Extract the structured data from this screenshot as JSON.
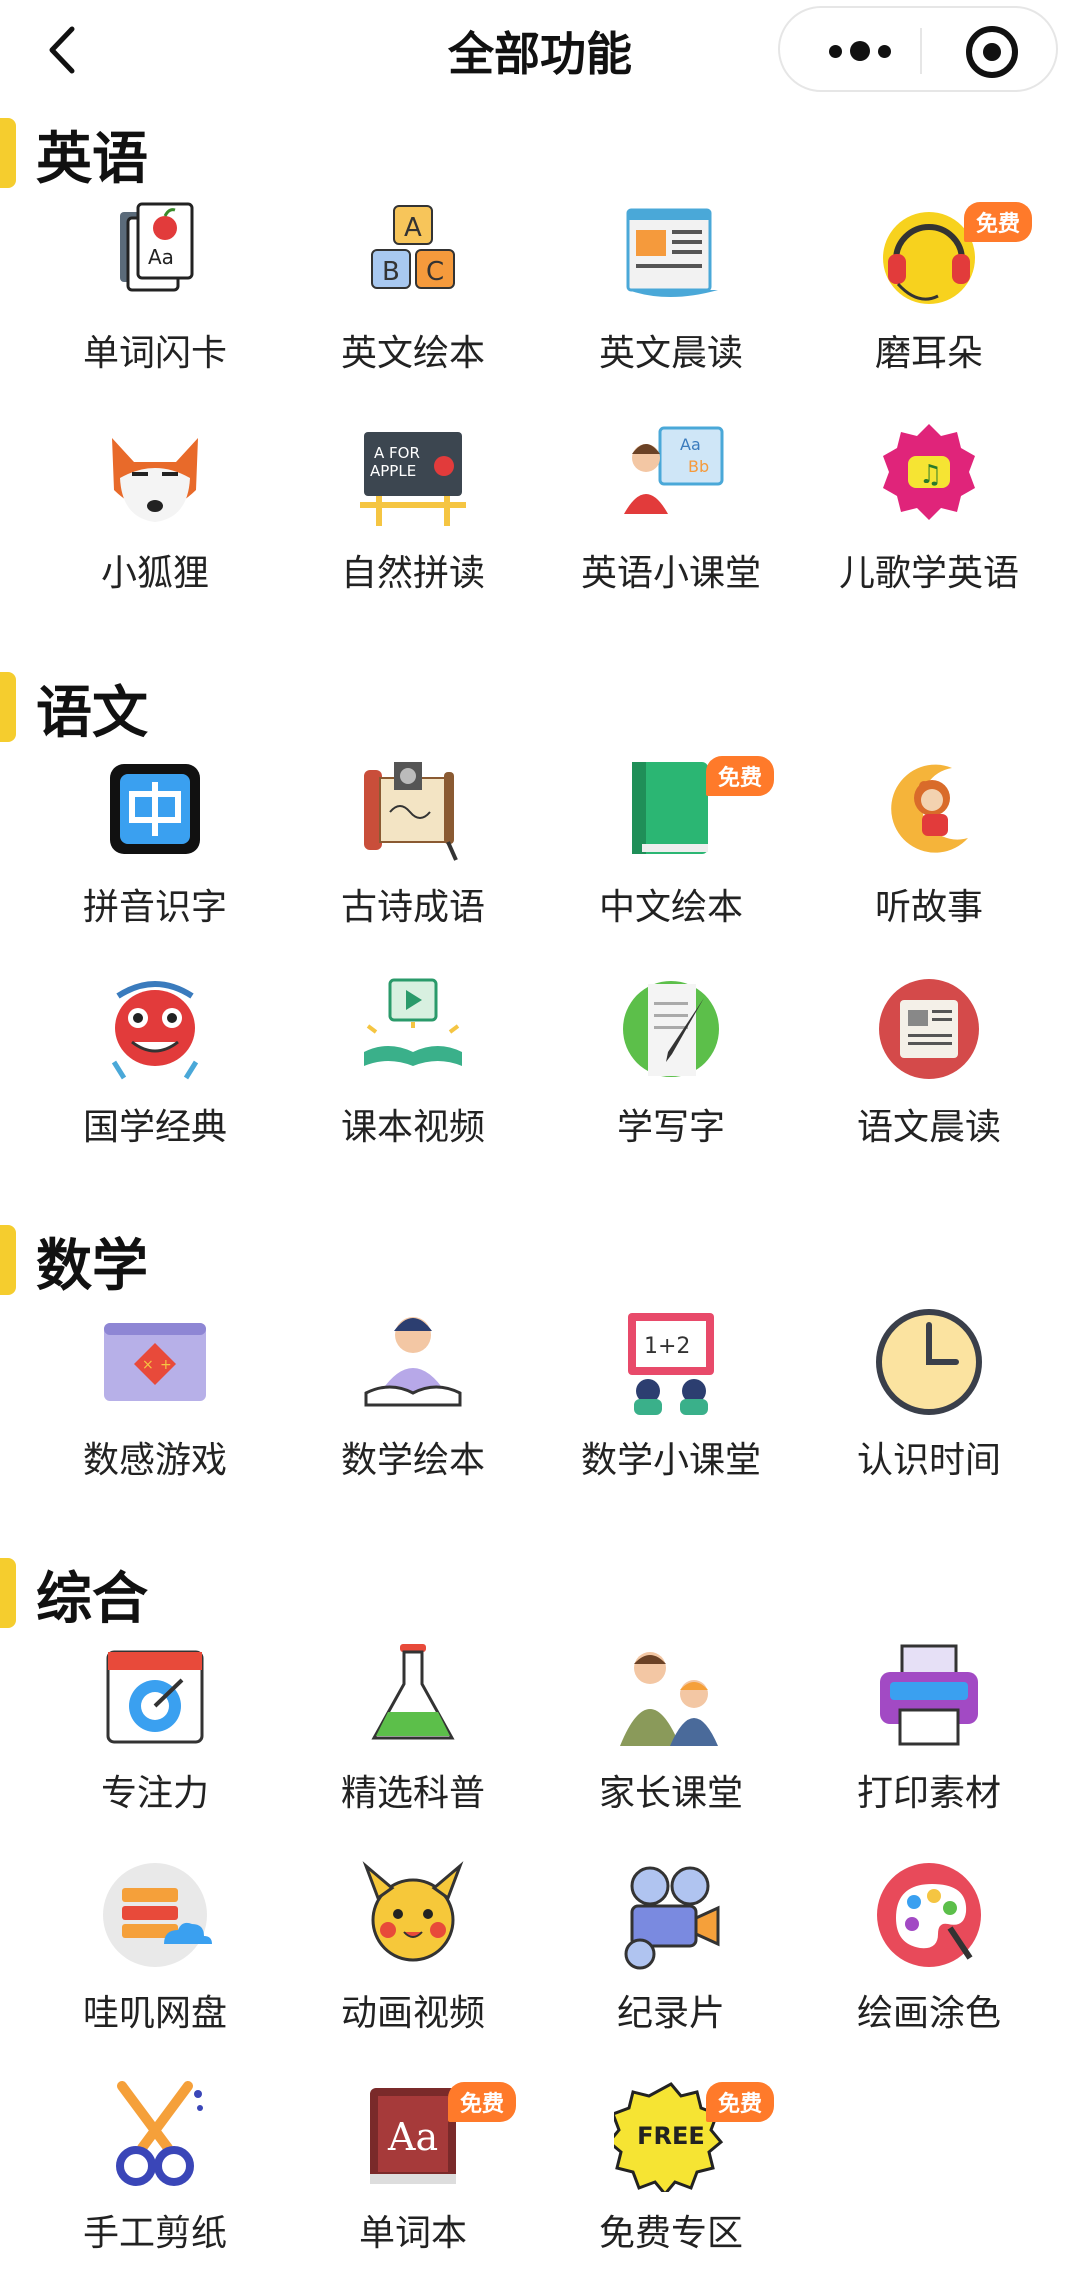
{
  "header": {
    "title": "全部功能"
  },
  "badge_text": "免费",
  "colors": {
    "accent": "#f5cd2e",
    "badge": "#ff7a2a"
  },
  "sections": [
    {
      "title": "英语",
      "items": [
        {
          "label": "单词闪卡",
          "icon": "flashcard-icon"
        },
        {
          "label": "英文绘本",
          "icon": "abc-blocks-icon"
        },
        {
          "label": "英文晨读",
          "icon": "newspaper-icon"
        },
        {
          "label": "磨耳朵",
          "icon": "headphones-icon",
          "badge": true
        },
        {
          "label": "小狐狸",
          "icon": "fox-icon"
        },
        {
          "label": "自然拼读",
          "icon": "phonics-board-icon"
        },
        {
          "label": "英语小课堂",
          "icon": "teacher-board-icon"
        },
        {
          "label": "儿歌学英语",
          "icon": "music-note-icon"
        }
      ]
    },
    {
      "title": "语文",
      "items": [
        {
          "label": "拼音识字",
          "icon": "chinese-char-icon"
        },
        {
          "label": "古诗成语",
          "icon": "scroll-icon"
        },
        {
          "label": "中文绘本",
          "icon": "green-book-icon",
          "badge": true
        },
        {
          "label": "听故事",
          "icon": "moon-monkey-icon"
        },
        {
          "label": "国学经典",
          "icon": "lion-dance-icon"
        },
        {
          "label": "课本视频",
          "icon": "video-book-icon"
        },
        {
          "label": "学写字",
          "icon": "pen-paper-icon"
        },
        {
          "label": "语文晨读",
          "icon": "newspaper-circle-icon"
        }
      ]
    },
    {
      "title": "数学",
      "items": [
        {
          "label": "数感游戏",
          "icon": "math-game-icon"
        },
        {
          "label": "数学绘本",
          "icon": "reading-kid-icon"
        },
        {
          "label": "数学小课堂",
          "icon": "math-class-icon"
        },
        {
          "label": "认识时间",
          "icon": "clock-icon"
        }
      ]
    },
    {
      "title": "综合",
      "items": [
        {
          "label": "专注力",
          "icon": "focus-calendar-icon"
        },
        {
          "label": "精选科普",
          "icon": "flask-icon"
        },
        {
          "label": "家长课堂",
          "icon": "parent-child-icon"
        },
        {
          "label": "打印素材",
          "icon": "printer-icon"
        },
        {
          "label": "哇叽网盘",
          "icon": "cloud-server-icon"
        },
        {
          "label": "动画视频",
          "icon": "pikachu-icon"
        },
        {
          "label": "纪录片",
          "icon": "film-camera-icon"
        },
        {
          "label": "绘画涂色",
          "icon": "palette-icon"
        },
        {
          "label": "手工剪纸",
          "icon": "scissors-icon"
        },
        {
          "label": "单词本",
          "icon": "dictionary-icon",
          "badge": true
        },
        {
          "label": "免费专区",
          "icon": "free-seal-icon",
          "badge": true,
          "seal_text": "FREE"
        }
      ]
    }
  ]
}
